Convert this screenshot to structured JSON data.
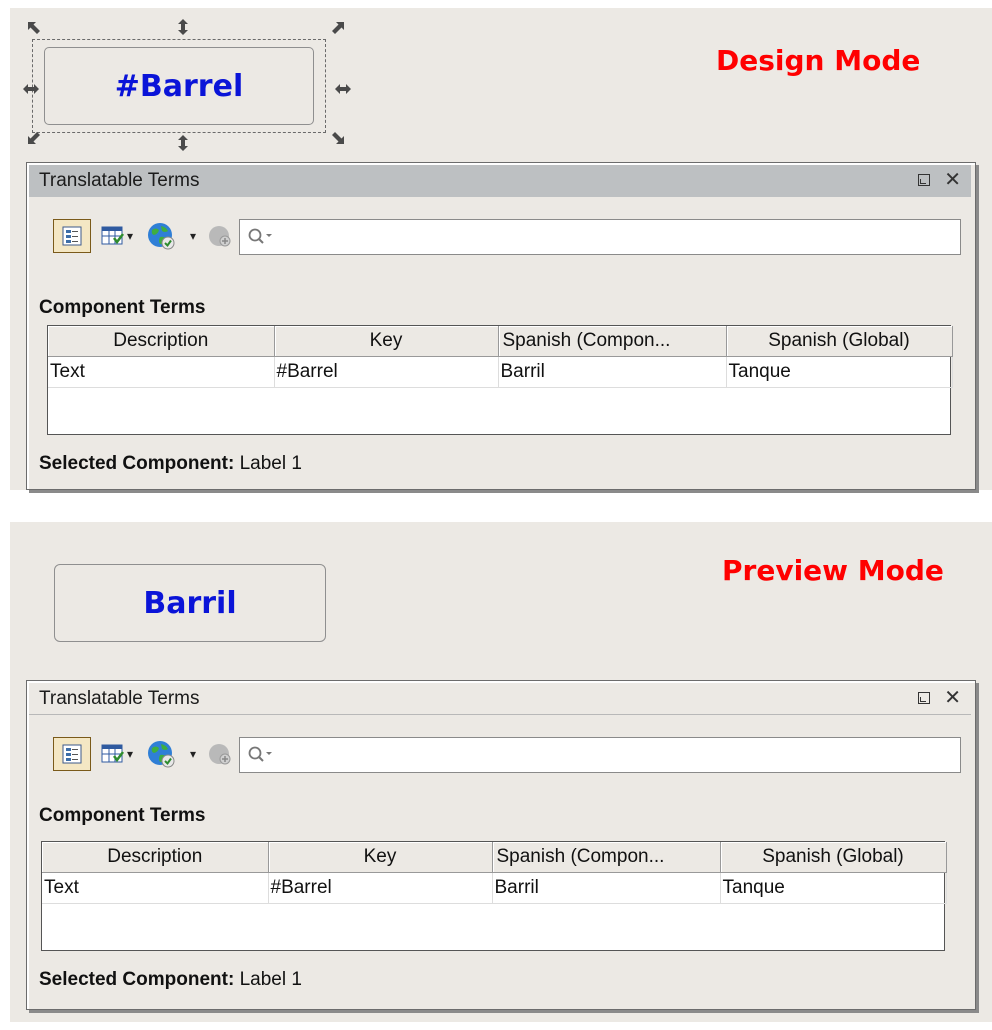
{
  "design": {
    "mode_title": "Design Mode",
    "label_text": "#Barrel"
  },
  "preview": {
    "mode_title": "Preview Mode",
    "label_text": "Barril"
  },
  "panel": {
    "title": "Translatable Terms",
    "float_icon": "float-window-icon",
    "close_icon": "close-icon",
    "close_glyph": "✕",
    "toolbar": {
      "buttons": [
        "component-terms-icon",
        "grid-filter-icon",
        "globe-language-icon",
        "add-term-icon"
      ],
      "search_placeholder": ""
    },
    "section_label": "Component Terms",
    "columns": [
      "Description",
      "Key",
      "Spanish (Compon...",
      "Spanish (Global)"
    ],
    "rows": [
      [
        "Text",
        "#Barrel",
        "Barril",
        "Tanque"
      ]
    ],
    "selected_label": "Selected Component:",
    "selected_value": "Label 1"
  },
  "colors": {
    "mode_title": "#ff0000",
    "label_text": "#0a14d8",
    "background": "#ECE9E4",
    "titlebar_active": "#BDC0C2"
  }
}
